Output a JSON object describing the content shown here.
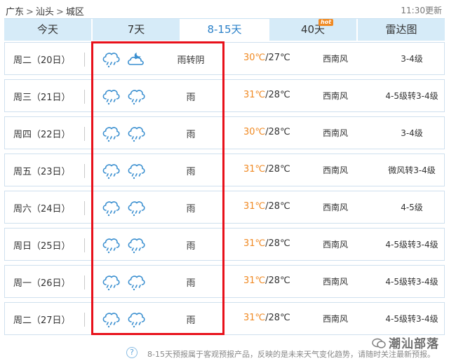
{
  "breadcrumb": {
    "province": "广东",
    "city": "汕头",
    "district": "城区",
    "separator": ">"
  },
  "updated": "11:30更新",
  "tabs": [
    {
      "label": "今天",
      "active": false
    },
    {
      "label": "7天",
      "active": false
    },
    {
      "label": "8-15天",
      "active": true
    },
    {
      "label": "40天",
      "active": false,
      "badge": "hot"
    },
    {
      "label": "雷达图",
      "active": false
    }
  ],
  "rows": [
    {
      "date": "周二（20日）",
      "icons": [
        "rain-icon",
        "partly-cloudy-night-icon"
      ],
      "desc": "雨转阴",
      "high": "30℃",
      "low": "/27℃",
      "wind": "西南风",
      "level": "3-4级"
    },
    {
      "date": "周三（21日）",
      "icons": [
        "rain-icon",
        "rain-icon"
      ],
      "desc": "雨",
      "high": "31℃",
      "low": "/28℃",
      "wind": "西南风",
      "level": "4-5级转3-4级"
    },
    {
      "date": "周四（22日）",
      "icons": [
        "rain-icon",
        "rain-icon"
      ],
      "desc": "雨",
      "high": "30℃",
      "low": "/28℃",
      "wind": "西南风",
      "level": "3-4级"
    },
    {
      "date": "周五（23日）",
      "icons": [
        "rain-icon",
        "rain-icon"
      ],
      "desc": "雨",
      "high": "31℃",
      "low": "/28℃",
      "wind": "西南风",
      "level": "微风转3-4级"
    },
    {
      "date": "周六（24日）",
      "icons": [
        "rain-icon",
        "rain-icon"
      ],
      "desc": "雨",
      "high": "31℃",
      "low": "/28℃",
      "wind": "西南风",
      "level": "4-5级"
    },
    {
      "date": "周日（25日）",
      "icons": [
        "rain-icon",
        "rain-icon"
      ],
      "desc": "雨",
      "high": "31℃",
      "low": "/28℃",
      "wind": "西南风",
      "level": "4-5级转3-4级"
    },
    {
      "date": "周一（26日）",
      "icons": [
        "rain-icon",
        "rain-icon"
      ],
      "desc": "雨",
      "high": "31℃",
      "low": "/28℃",
      "wind": "西南风",
      "level": "4-5级转3-4级"
    },
    {
      "date": "周二（27日）",
      "icons": [
        "rain-icon",
        "rain-icon"
      ],
      "desc": "雨",
      "high": "31℃",
      "low": "/28℃",
      "wind": "西南风",
      "level": "4-5级转3-4级"
    }
  ],
  "footer": {
    "note": "8-15天预报属于客观预报产品，反映的是未来天气变化趋势，请随时关注最新预报。",
    "help_icon": "question-icon",
    "help_glyph": "?"
  },
  "watermark": "潮汕部落",
  "colors": {
    "accent": "#2a80c8",
    "tab_bg": "#d6ebf8",
    "high_temp": "#f08a24",
    "highlight_box": "#e8101a",
    "hot_badge": "#f08a24"
  }
}
